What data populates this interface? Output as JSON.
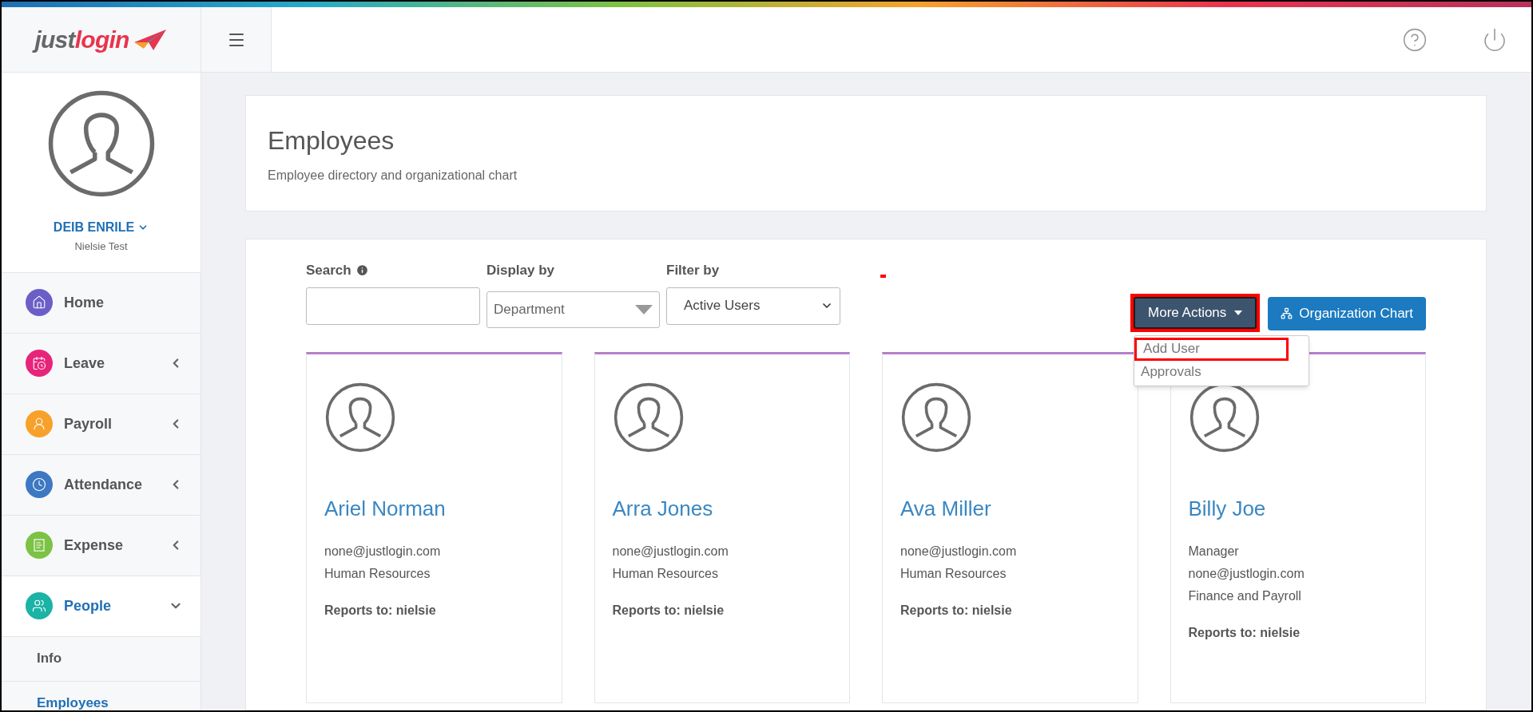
{
  "logo": {
    "part_1": "just",
    "part_2": "login"
  },
  "user": {
    "name": "DEIB ENRILE",
    "company": "Nielsie Test"
  },
  "sidebar": {
    "items": [
      {
        "kind": "home",
        "label": "Home",
        "color": "#6b5fc7",
        "selected": false
      },
      {
        "kind": "leave",
        "label": "Leave",
        "color": "#e8247a",
        "selected": false,
        "expanded": false
      },
      {
        "kind": "payroll",
        "label": "Payroll",
        "color": "#f7a12b",
        "selected": false,
        "expanded": false
      },
      {
        "kind": "attendance",
        "label": "Attendance",
        "color": "#3d78c2",
        "selected": false,
        "expanded": false
      },
      {
        "kind": "expense",
        "label": "Expense",
        "color": "#7cc244",
        "selected": false,
        "expanded": false
      },
      {
        "kind": "people",
        "label": "People",
        "color": "#1bb3a6",
        "selected": true,
        "expanded": true,
        "children": [
          {
            "label": "Info",
            "selected": false
          },
          {
            "label": "Employees",
            "selected": true
          }
        ]
      }
    ]
  },
  "header": {
    "title": "Employees",
    "subtitle": "Employee directory and organizational chart"
  },
  "filters": {
    "search_label": "Search",
    "display_label": "Display by",
    "display_value": "Department",
    "filter_label": "Filter by",
    "filter_value": "Active Users"
  },
  "more_actions": {
    "label": "More Actions",
    "highlighted": true,
    "expanded": true,
    "menu": [
      {
        "label": "Add User",
        "highlighted": true
      },
      {
        "label": "Approvals",
        "highlighted": false
      }
    ]
  },
  "org_chart_button": "Organization Chart",
  "employees": [
    {
      "name": "Ariel Norman",
      "lines": [
        "none@justlogin.com",
        "Human Resources"
      ],
      "reports_to": "Reports to: nielsie"
    },
    {
      "name": "Arra Jones",
      "lines": [
        "none@justlogin.com",
        "Human Resources"
      ],
      "reports_to": "Reports to: nielsie"
    },
    {
      "name": "Ava Miller",
      "lines": [
        "none@justlogin.com",
        "Human Resources"
      ],
      "reports_to": "Reports to: nielsie"
    },
    {
      "name": "Billy Joe",
      "lines": [
        "Manager",
        "none@justlogin.com",
        "Finance and Payroll"
      ],
      "reports_to": "Reports to: nielsie"
    }
  ]
}
